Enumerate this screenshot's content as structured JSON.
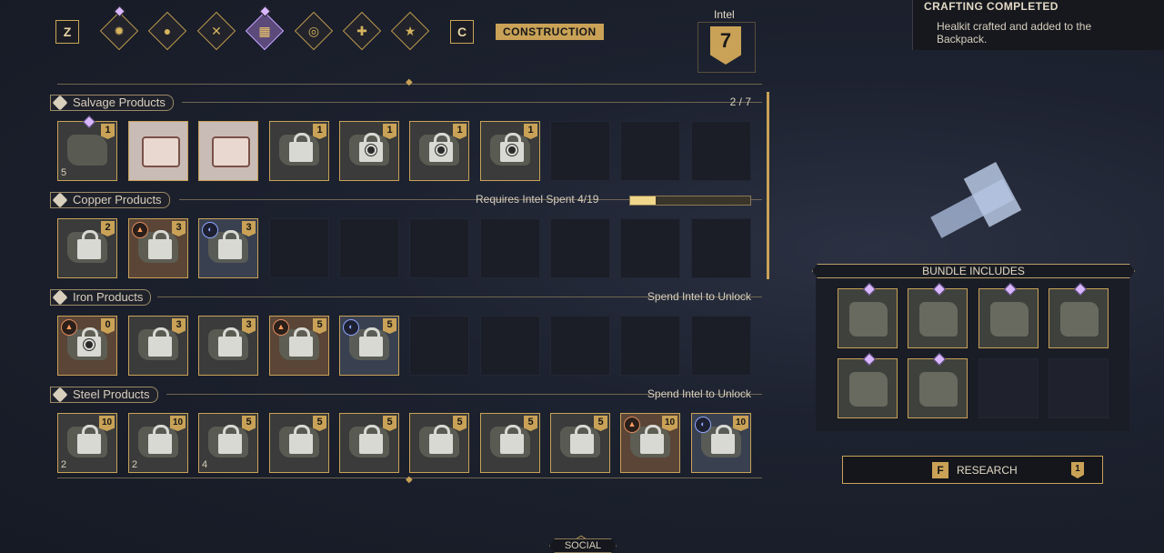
{
  "toolbar": {
    "prev_key": "Z",
    "next_key": "C",
    "categories": [
      {
        "icon": "gear-ring-icon",
        "glyph": "✹",
        "active": false,
        "new": true
      },
      {
        "icon": "droplet-icon",
        "glyph": "●",
        "active": false,
        "new": false
      },
      {
        "icon": "crossed-tools-icon",
        "glyph": "✕",
        "active": false,
        "new": false
      },
      {
        "icon": "construction-bricks-icon",
        "glyph": "▦",
        "active": true,
        "new": true
      },
      {
        "icon": "swirl-icon",
        "glyph": "◎",
        "active": false,
        "new": false
      },
      {
        "icon": "medkit-icon",
        "glyph": "✚",
        "active": false,
        "new": false
      },
      {
        "icon": "star-burst-icon",
        "glyph": "★",
        "active": false,
        "new": false
      }
    ],
    "active_category": "CONSTRUCTION"
  },
  "intel": {
    "label": "Intel",
    "value": "7"
  },
  "notification": {
    "title": "CRAFTING COMPLETED",
    "message": "Healkit crafted and added to the Backpack."
  },
  "sections": [
    {
      "name": "Salvage Products",
      "right_text": "2 / 7",
      "slots": [
        {
          "state": "owned",
          "count": "1",
          "qty": "5",
          "new": true
        },
        {
          "state": "craft",
          "count": "",
          "qty": ""
        },
        {
          "state": "craft",
          "count": "",
          "qty": ""
        },
        {
          "state": "locked",
          "count": "1"
        },
        {
          "state": "locked-gear",
          "count": "1"
        },
        {
          "state": "locked-gear",
          "count": "1"
        },
        {
          "state": "locked-gear",
          "count": "1"
        },
        {
          "state": "empty"
        },
        {
          "state": "empty"
        },
        {
          "state": "empty"
        }
      ]
    },
    {
      "name": "Copper Products",
      "right_text": "Requires Intel Spent 4/19",
      "progress": 0.21,
      "slots": [
        {
          "state": "locked",
          "count": "2"
        },
        {
          "state": "locked",
          "count": "3",
          "tier": "copper"
        },
        {
          "state": "locked",
          "count": "3",
          "tier": "blue"
        },
        {
          "state": "empty"
        },
        {
          "state": "empty"
        },
        {
          "state": "empty"
        },
        {
          "state": "empty"
        },
        {
          "state": "empty"
        },
        {
          "state": "empty"
        },
        {
          "state": "empty"
        }
      ]
    },
    {
      "name": "Iron Products",
      "right_text": "Spend Intel to Unlock",
      "slots": [
        {
          "state": "locked-gear",
          "count": "0",
          "tier": "copper"
        },
        {
          "state": "locked",
          "count": "3"
        },
        {
          "state": "locked",
          "count": "3"
        },
        {
          "state": "locked",
          "count": "5",
          "tier": "copper"
        },
        {
          "state": "locked",
          "count": "5",
          "tier": "blue"
        },
        {
          "state": "empty"
        },
        {
          "state": "empty"
        },
        {
          "state": "empty"
        },
        {
          "state": "empty"
        },
        {
          "state": "empty"
        }
      ]
    },
    {
      "name": "Steel Products",
      "right_text": "Spend Intel to Unlock",
      "slots": [
        {
          "state": "locked",
          "count": "10",
          "qty": "2"
        },
        {
          "state": "locked",
          "count": "10",
          "qty": "2"
        },
        {
          "state": "locked",
          "count": "5",
          "qty": "4"
        },
        {
          "state": "locked",
          "count": "5"
        },
        {
          "state": "locked",
          "count": "5"
        },
        {
          "state": "locked",
          "count": "5"
        },
        {
          "state": "locked",
          "count": "5"
        },
        {
          "state": "locked",
          "count": "5"
        },
        {
          "state": "locked",
          "count": "10",
          "tier": "copper"
        },
        {
          "state": "locked",
          "count": "10",
          "tier": "blue"
        }
      ]
    }
  ],
  "bundle": {
    "title": "BUNDLE INCLUDES",
    "items": [
      {
        "filled": true
      },
      {
        "filled": true
      },
      {
        "filled": true
      },
      {
        "filled": true
      },
      {
        "filled": true
      },
      {
        "filled": true
      },
      {
        "filled": false
      },
      {
        "filled": false
      }
    ]
  },
  "research": {
    "key": "F",
    "label": "RESEARCH",
    "cost": "1"
  },
  "social": {
    "label": "SOCIAL"
  }
}
